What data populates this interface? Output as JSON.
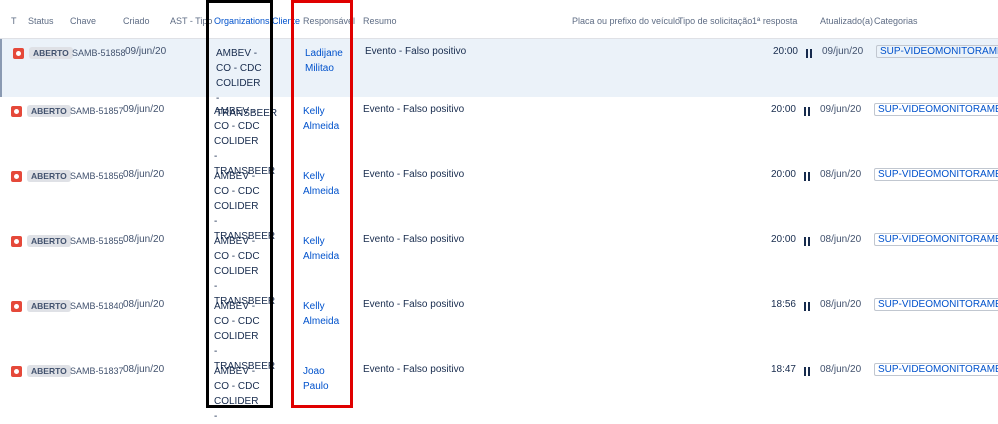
{
  "columns": {
    "t": "T",
    "status": "Status",
    "chave": "Chave",
    "criado": "Criado",
    "ast": "AST - Tipo",
    "organizations": "Organizations",
    "cliente": "Cliente",
    "responsavel": "Responsável",
    "resumo": "Resumo",
    "placa": "Placa ou prefixo do veículo",
    "tipo_solicitacao": "Tipo de solicitação",
    "primeira_resposta": "1ª resposta",
    "atualizado": "Atualizado(a)",
    "categorias": "Categorias"
  },
  "rows": [
    {
      "status": "ABERTO",
      "key": "SAMB-51858",
      "created": "09/jun/20",
      "org": "AMBEV - CO - CDC COLIDER - TRANSBEER",
      "assignee": "Ladijane Militao",
      "summary": "Evento - Falso positivo",
      "first_response": "20:00",
      "updated": "09/jun/20",
      "category": "SUP-VIDEOMONITORAMENTO"
    },
    {
      "status": "ABERTO",
      "key": "SAMB-51857",
      "created": "09/jun/20",
      "org": "AMBEV - CO - CDC COLIDER - TRANSBEER",
      "assignee": "Kelly Almeida",
      "summary": "Evento - Falso positivo",
      "first_response": "20:00",
      "updated": "09/jun/20",
      "category": "SUP-VIDEOMONITORAMENTO"
    },
    {
      "status": "ABERTO",
      "key": "SAMB-51856",
      "created": "08/jun/20",
      "org": "AMBEV - CO - CDC COLIDER - TRANSBEER",
      "assignee": "Kelly Almeida",
      "summary": "Evento - Falso positivo",
      "first_response": "20:00",
      "updated": "08/jun/20",
      "category": "SUP-VIDEOMONITORAMENTO"
    },
    {
      "status": "ABERTO",
      "key": "SAMB-51855",
      "created": "08/jun/20",
      "org": "AMBEV - CO - CDC COLIDER - TRANSBEER",
      "assignee": "Kelly Almeida",
      "summary": "Evento - Falso positivo",
      "first_response": "20:00",
      "updated": "08/jun/20",
      "category": "SUP-VIDEOMONITORAMENTO"
    },
    {
      "status": "ABERTO",
      "key": "SAMB-51840",
      "created": "08/jun/20",
      "org": "AMBEV - CO - CDC COLIDER - TRANSBEER",
      "assignee": "Kelly Almeida",
      "summary": "Evento - Falso positivo",
      "first_response": "18:56",
      "updated": "08/jun/20",
      "category": "SUP-VIDEOMONITORAMENTO"
    },
    {
      "status": "ABERTO",
      "key": "SAMB-51837",
      "created": "08/jun/20",
      "org": "AMBEV - CO - CDC COLIDER -",
      "assignee": "Joao Paulo",
      "summary": "Evento - Falso positivo",
      "first_response": "18:47",
      "updated": "08/jun/20",
      "category": "SUP-VIDEOMONITORAMENTO"
    }
  ],
  "colors": {
    "highlight_black": "#000000",
    "highlight_red": "#e00000",
    "selected_row": "#ebf2f9",
    "link": "#0052cc"
  }
}
